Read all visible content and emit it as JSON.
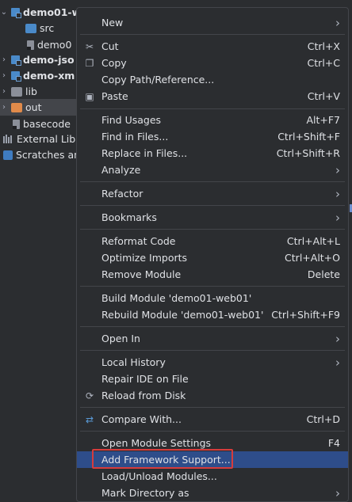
{
  "tree": {
    "rows": [
      {
        "label": "demo01-w",
        "bold": true
      },
      {
        "label": "src"
      },
      {
        "label": "demo0"
      },
      {
        "label": "demo-jso",
        "bold": true
      },
      {
        "label": "demo-xm",
        "bold": true
      },
      {
        "label": "lib"
      },
      {
        "label": "out"
      },
      {
        "label": "basecode"
      },
      {
        "label": "External Libr"
      },
      {
        "label": "Scratches an"
      }
    ]
  },
  "menu": {
    "items": [
      {
        "label": "New",
        "shortcut": "",
        "submenu": true
      },
      {
        "label": "Cut",
        "shortcut": "Ctrl+X",
        "icon": "cut-icon"
      },
      {
        "label": "Copy",
        "shortcut": "Ctrl+C",
        "icon": "copy-icon"
      },
      {
        "label": "Copy Path/Reference...",
        "shortcut": ""
      },
      {
        "label": "Paste",
        "shortcut": "Ctrl+V",
        "icon": "paste-icon"
      },
      {
        "label": "Find Usages",
        "shortcut": "Alt+F7"
      },
      {
        "label": "Find in Files...",
        "shortcut": "Ctrl+Shift+F"
      },
      {
        "label": "Replace in Files...",
        "shortcut": "Ctrl+Shift+R"
      },
      {
        "label": "Analyze",
        "shortcut": "",
        "submenu": true
      },
      {
        "label": "Refactor",
        "shortcut": "",
        "submenu": true
      },
      {
        "label": "Bookmarks",
        "shortcut": "",
        "submenu": true
      },
      {
        "label": "Reformat Code",
        "shortcut": "Ctrl+Alt+L"
      },
      {
        "label": "Optimize Imports",
        "shortcut": "Ctrl+Alt+O"
      },
      {
        "label": "Remove Module",
        "shortcut": "Delete"
      },
      {
        "label": "Build Module 'demo01-web01'",
        "shortcut": ""
      },
      {
        "label": "Rebuild Module 'demo01-web01'",
        "shortcut": "Ctrl+Shift+F9"
      },
      {
        "label": "Open In",
        "shortcut": "",
        "submenu": true
      },
      {
        "label": "Local History",
        "shortcut": "",
        "submenu": true
      },
      {
        "label": "Repair IDE on File",
        "shortcut": ""
      },
      {
        "label": "Reload from Disk",
        "shortcut": "",
        "icon": "reload-icon"
      },
      {
        "label": "Compare With...",
        "shortcut": "Ctrl+D",
        "icon": "compare-icon"
      },
      {
        "label": "Open Module Settings",
        "shortcut": "F4"
      },
      {
        "label": "Add Framework Support...",
        "shortcut": "",
        "highlighted": true
      },
      {
        "label": "Load/Unload Modules...",
        "shortcut": ""
      },
      {
        "label": "Mark Directory as",
        "shortcut": "",
        "submenu": true
      }
    ]
  },
  "colors": {
    "highlight": "#2e4d8a",
    "annotation_box": "#d63c3c"
  }
}
